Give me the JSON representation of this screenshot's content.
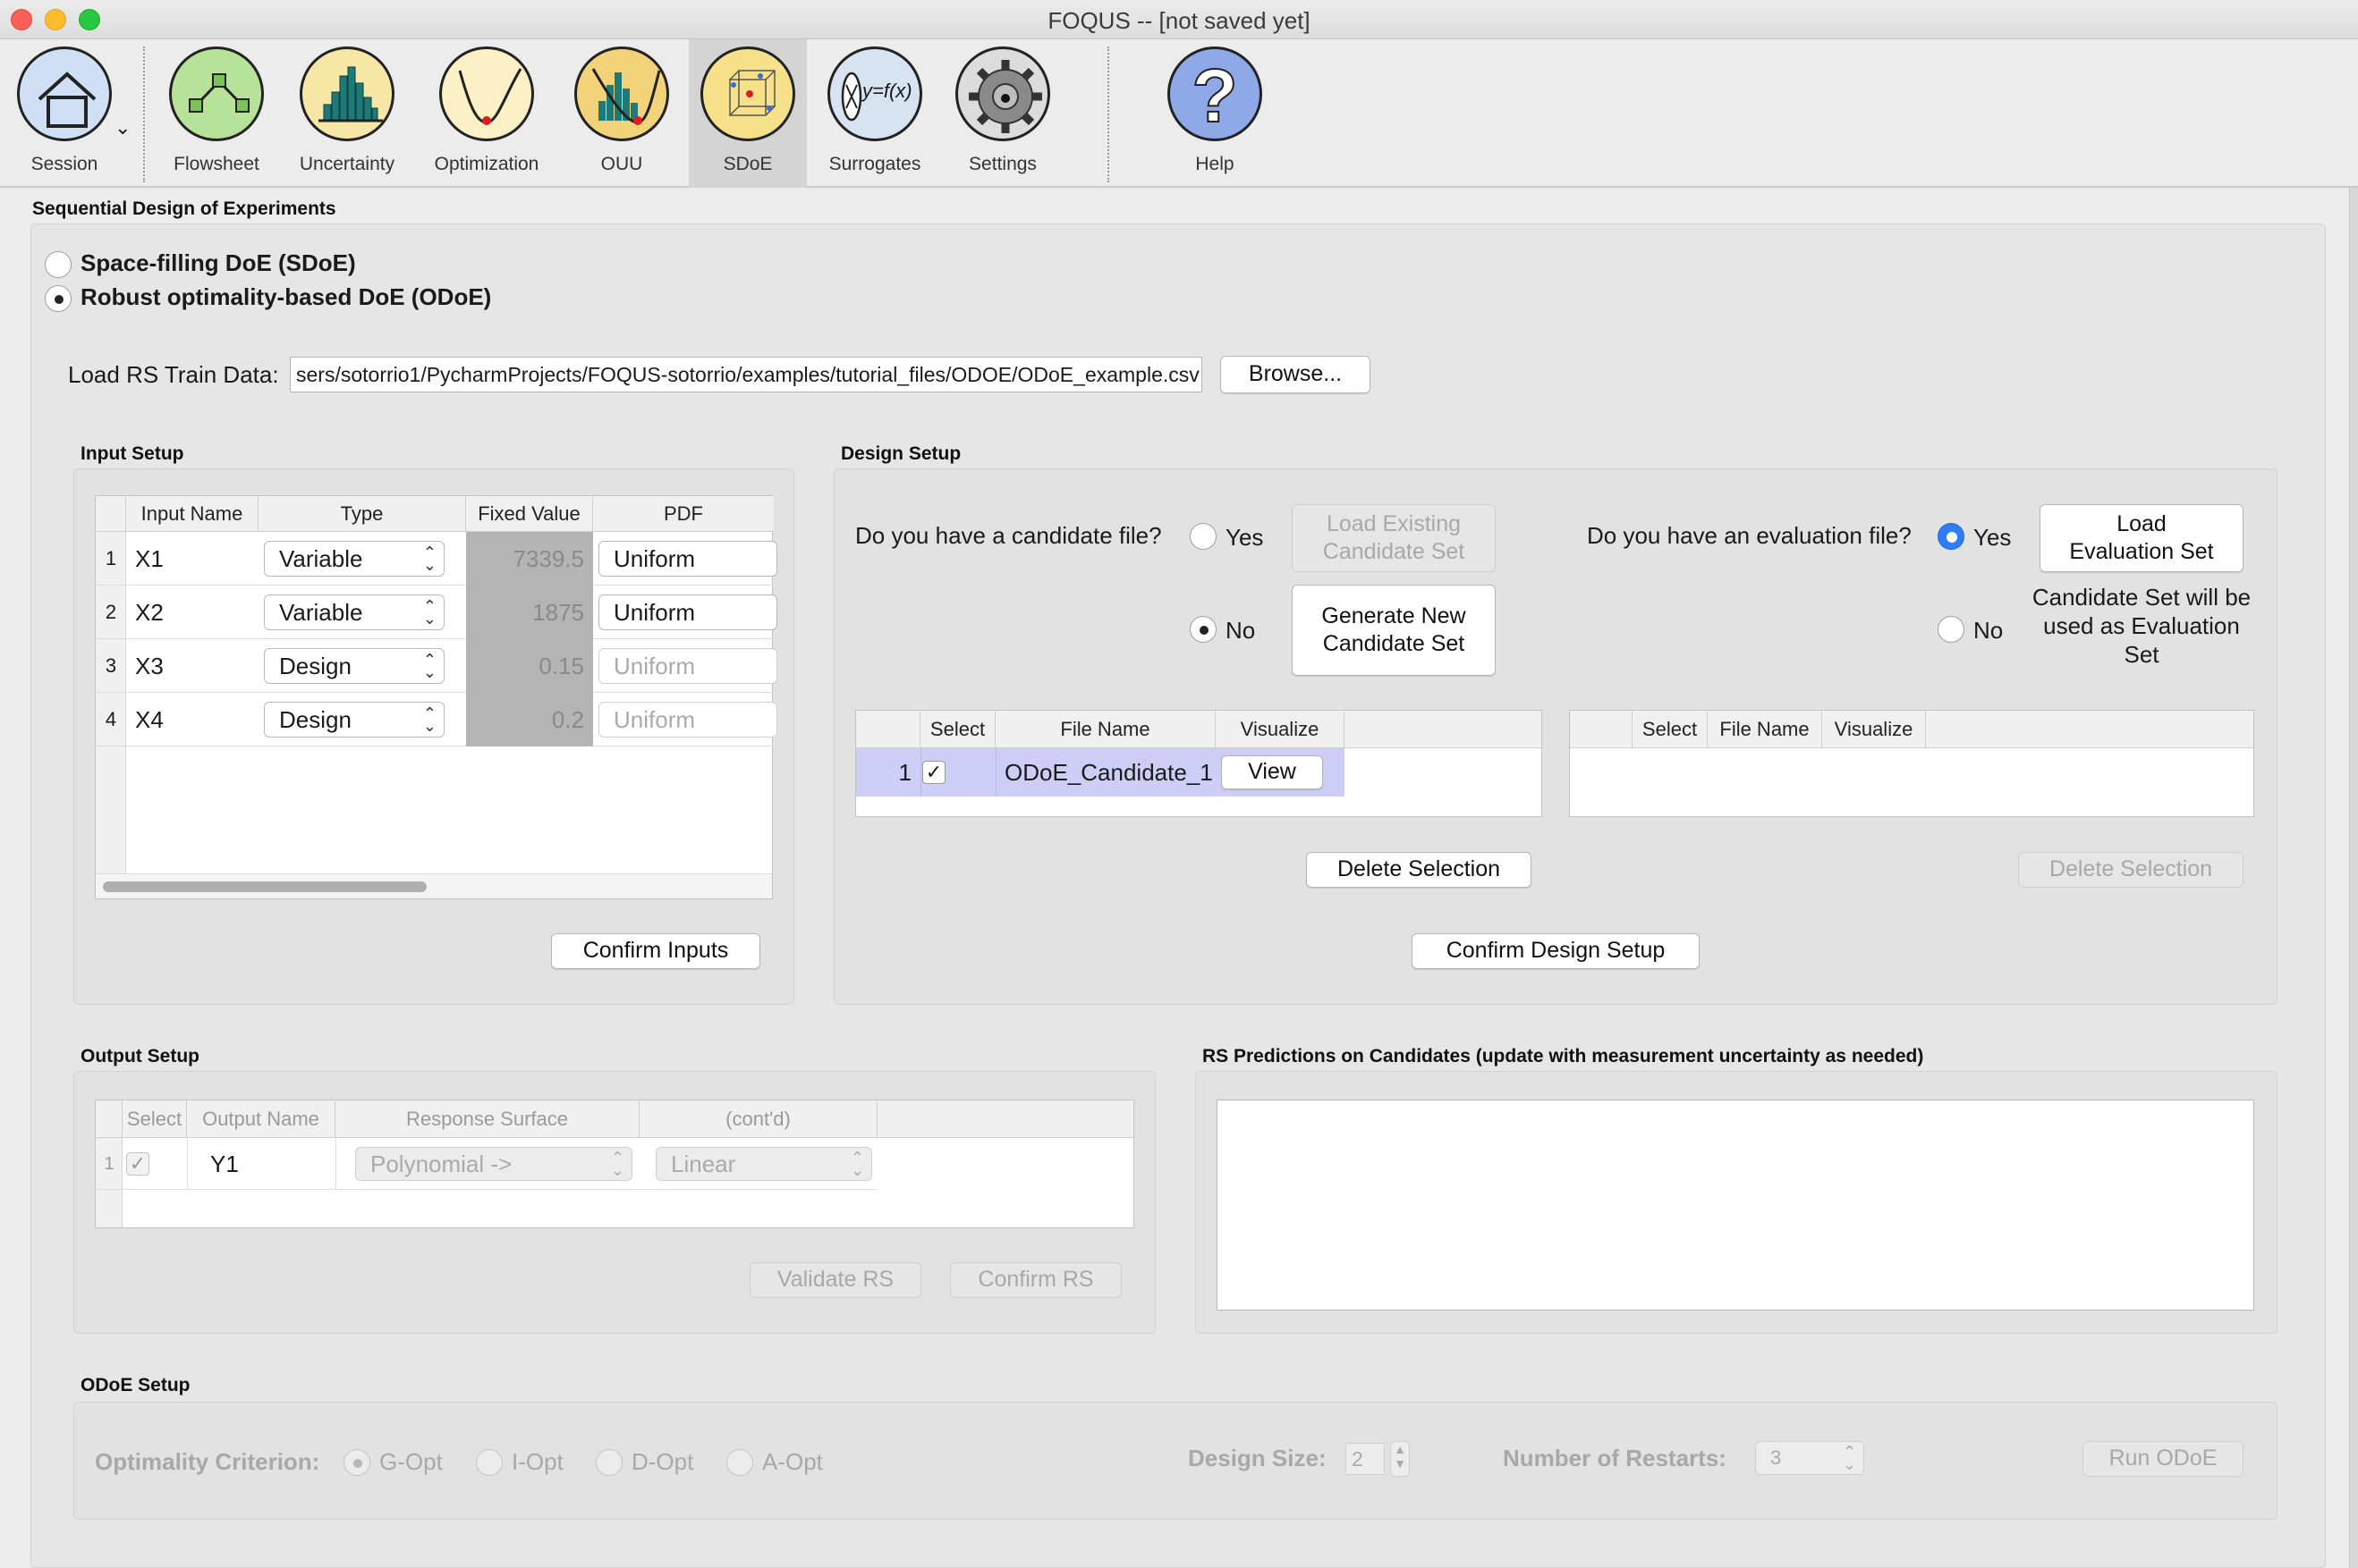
{
  "window": {
    "title": "FOQUS -- [not saved yet]"
  },
  "toolbar": {
    "items": [
      {
        "label": "Session"
      },
      {
        "label": "Flowsheet"
      },
      {
        "label": "Uncertainty"
      },
      {
        "label": "Optimization"
      },
      {
        "label": "OUU"
      },
      {
        "label": "SDoE"
      },
      {
        "label": "Surrogates"
      },
      {
        "label": "Settings"
      },
      {
        "label": "Help"
      }
    ],
    "active": "SDoE",
    "surrogate_icon_text": "y=f(x)"
  },
  "page": {
    "title": "Sequential Design of Experiments",
    "mode_sdoe": "Space-filling DoE (SDoE)",
    "mode_odoe": "Robust optimality-based DoE (ODoE)",
    "load_label": "Load RS Train Data:",
    "load_path": "sers/sotorrio1/PycharmProjects/FOQUS-sotorrio/examples/tutorial_files/ODOE/ODoE_example.csv",
    "browse": "Browse..."
  },
  "input_setup": {
    "title": "Input Setup",
    "columns": [
      "Input Name",
      "Type",
      "Fixed Value",
      "PDF"
    ],
    "rows": [
      {
        "num": "1",
        "name": "X1",
        "type": "Variable",
        "fixed": "7339.5",
        "pdf": "Uniform"
      },
      {
        "num": "2",
        "name": "X2",
        "type": "Variable",
        "fixed": "1875",
        "pdf": "Uniform"
      },
      {
        "num": "3",
        "name": "X3",
        "type": "Design",
        "fixed": "0.15",
        "pdf": "Uniform"
      },
      {
        "num": "4",
        "name": "X4",
        "type": "Design",
        "fixed": "0.2",
        "pdf": "Uniform"
      }
    ],
    "confirm": "Confirm Inputs"
  },
  "design_setup": {
    "title": "Design Setup",
    "candidate_q": "Do you have a candidate file?",
    "yes": "Yes",
    "no": "No",
    "load_existing": "Load Existing Candidate Set",
    "generate_new": "Generate New Candidate Set",
    "eval_q": "Do you have an evaluation file?",
    "load_eval": "Load Evaluation Set",
    "eval_note": "Candidate Set will be used as Evaluation Set",
    "cand_columns": [
      "Select",
      "File Name",
      "Visualize"
    ],
    "cand_rows": [
      {
        "num": "1",
        "checked": "✓",
        "file": "ODoE_Candidate_1",
        "visualize": "View"
      }
    ],
    "eval_columns": [
      "Select",
      "File Name",
      "Visualize"
    ],
    "delete_selection": "Delete Selection",
    "delete_selection_eval": "Delete Selection",
    "confirm": "Confirm Design Setup"
  },
  "output_setup": {
    "title": "Output Setup",
    "columns": [
      "Select",
      "Output Name",
      "Response Surface",
      "(cont'd)"
    ],
    "rows": [
      {
        "num": "1",
        "checked": "✓",
        "name": "Y1",
        "rs": "Polynomial ->",
        "cont": "Linear"
      }
    ],
    "validate": "Validate RS",
    "confirm": "Confirm RS"
  },
  "rs_predictions": {
    "title": "RS Predictions on Candidates (update with measurement uncertainty as needed)"
  },
  "odoe_setup": {
    "title": "ODoE Setup",
    "criterion_label": "Optimality Criterion:",
    "options": [
      "G-Opt",
      "I-Opt",
      "D-Opt",
      "A-Opt"
    ],
    "design_size_label": "Design Size:",
    "design_size": "2",
    "restarts_label": "Number of Restarts:",
    "restarts": "3",
    "run": "Run ODoE"
  }
}
